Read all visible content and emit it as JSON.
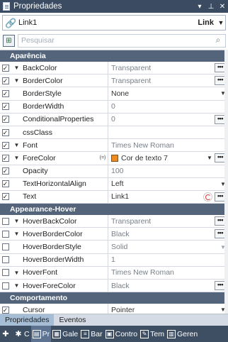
{
  "window": {
    "title": "Propriedades",
    "pin_glyph": "▾",
    "pin_glyph2": "⊥",
    "close_glyph": "✕"
  },
  "selector": {
    "icon": "link-icon",
    "name": "Link1",
    "type": "Link"
  },
  "search": {
    "placeholder": "Pesquisar"
  },
  "categories": {
    "aparencia": "Aparência",
    "hover": "Appearance-Hover",
    "comportamento": "Comportamento"
  },
  "rows": {
    "backcolor": {
      "name": "BackColor",
      "value": "Transparent"
    },
    "bordercolor": {
      "name": "BorderColor",
      "value": "Transparent"
    },
    "borderstyle": {
      "name": "BorderStyle",
      "value": "None"
    },
    "borderwidth": {
      "name": "BorderWidth",
      "value": "0"
    },
    "conditional": {
      "name": "ConditionalProperties",
      "value": "0"
    },
    "cssclass": {
      "name": "cssClass",
      "value": ""
    },
    "font": {
      "name": "Font",
      "value": "Times New Roman"
    },
    "forecolor": {
      "name": "ForeColor",
      "marker": "(=)",
      "value": "Cor de texto 7",
      "swatch": "#ee8a22"
    },
    "opacity": {
      "name": "Opacity",
      "value": "100"
    },
    "textalign": {
      "name": "TextHorizontalAlign",
      "value": "Left"
    },
    "text": {
      "name": "Text",
      "value": "Link1"
    },
    "hoverback": {
      "name": "HoverBackColor",
      "value": "Transparent"
    },
    "hoverborder": {
      "name": "HoverBorderColor",
      "value": "Black"
    },
    "hoverborderstyle": {
      "name": "HoverBorderStyle",
      "value": "Solid"
    },
    "hoverborderwidth": {
      "name": "HoverBorderWidth",
      "value": "1"
    },
    "hoverfont": {
      "name": "HoverFont",
      "value": "Times New Roman"
    },
    "hoverfore": {
      "name": "HoverForeColor",
      "value": "Black"
    },
    "cursor": {
      "name": "Cursor",
      "value": "Pointer"
    }
  },
  "bottom_tabs": [
    "Propriedades",
    "Eventos"
  ],
  "dock": [
    "C",
    "Pr",
    "Gale",
    "Bar",
    "Contro",
    "Tem",
    "Geren"
  ]
}
